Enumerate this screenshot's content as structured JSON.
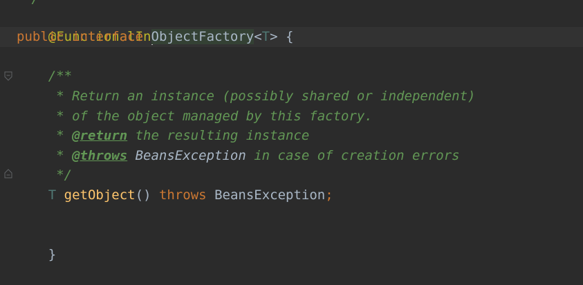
{
  "editor": {
    "partial_top": "*/",
    "annotation": "@FunctionalInterface",
    "decl": {
      "kw_public": "public",
      "kw_interface": "interface",
      "name": "ObjectFactory",
      "lt": "<",
      "type_param": "T",
      "gt": ">",
      "brace_open": "{"
    },
    "javadoc": {
      "open": "/**",
      "line1": "* Return an instance (possibly shared or independent)",
      "line2": "* of the object managed by this factory.",
      "return_star": "* ",
      "return_tag": "@return",
      "return_text": " the resulting instance",
      "throws_star": "* ",
      "throws_tag": "@throws",
      "throws_ref": " BeansException",
      "throws_text": " in case of creation errors",
      "close": "*/"
    },
    "method": {
      "return_type": "T",
      "name": "getObject",
      "parens": "()",
      "kw_throws": "throws",
      "exception": "BeansException",
      "semicolon": ";"
    },
    "brace_close": "}"
  },
  "colors": {
    "background": "#2b2b2b",
    "keyword": "#cc7832",
    "annotation": "#bbb529",
    "method": "#ffc66d",
    "comment": "#629755",
    "text": "#a9b7c6"
  }
}
